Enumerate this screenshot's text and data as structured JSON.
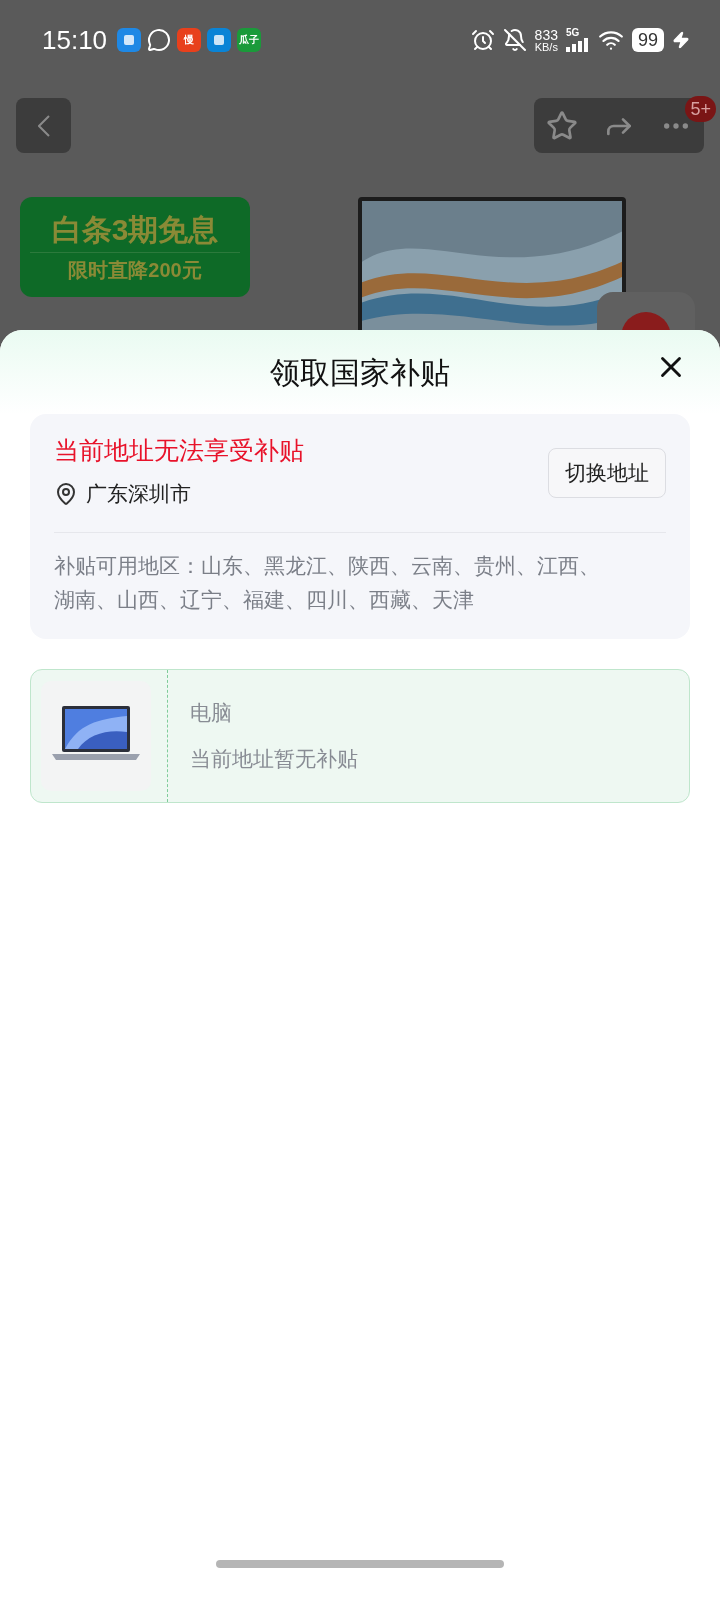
{
  "status_bar": {
    "time": "15:10",
    "apps": [
      {
        "kind": "plain",
        "color": "#1e88e5"
      },
      {
        "kind": "chat",
        "color": "#ffffff"
      },
      {
        "kind": "text",
        "color": "#e8401c",
        "label": "慢"
      },
      {
        "kind": "plain",
        "color": "#0a84d6"
      },
      {
        "kind": "text",
        "color": "#1a9a3a",
        "label": "瓜子"
      }
    ],
    "speed": "833",
    "speed_unit": "KB/s",
    "network": "5G",
    "battery": "99"
  },
  "nav": {
    "badge": "5+"
  },
  "promo": {
    "title": "白条3期免息",
    "subtitle": "限时直降200元"
  },
  "sheet": {
    "title": "领取国家补贴",
    "address_card": {
      "warning": "当前地址无法享受补贴",
      "location": "广东深圳市",
      "switch_button": "切换地址",
      "regions": "补贴可用地区：山东、黑龙江、陕西、云南、贵州、江西、湖南、山西、辽宁、福建、四川、西藏、天津"
    },
    "products": [
      {
        "name": "电脑",
        "status": "当前地址暂无补贴"
      }
    ]
  }
}
